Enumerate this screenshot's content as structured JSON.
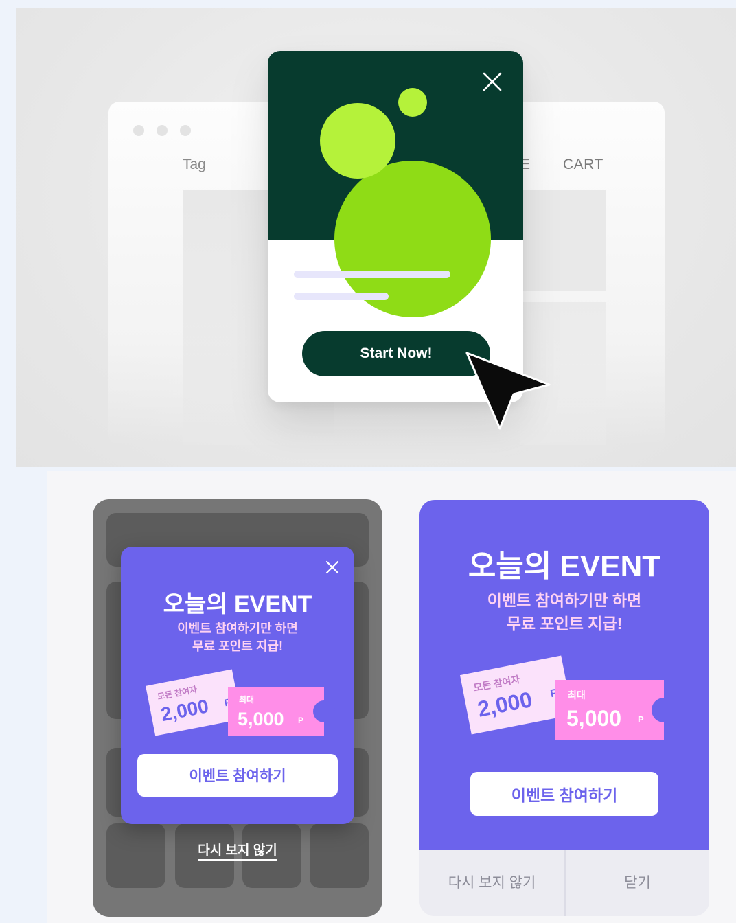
{
  "top_scene": {
    "browser": {
      "nav": {
        "tag": "Tag",
        "partial": "E",
        "cart": "CART"
      }
    },
    "modal": {
      "start_label": "Start Now!"
    },
    "colors": {
      "hero_bg": "#073b2e",
      "blob_light": "#b5f23a",
      "blob_main": "#8fdc16",
      "button": "#073b2e",
      "skeleton": "#e7e6fb"
    }
  },
  "event_small": {
    "title": "오늘의 EVENT",
    "subtitle_line1": "이벤트 참여하기만 하면",
    "subtitle_line2": "무료 포인트 지급!",
    "coupon_a": {
      "label": "모든 참여자",
      "value": "2,000",
      "unit": "P"
    },
    "coupon_b": {
      "label": "최대",
      "value": "5,000",
      "unit": "P"
    },
    "join_label": "이벤트 참여하기",
    "dont_show": "다시 보지 않기"
  },
  "event_card": {
    "title": "오늘의 EVENT",
    "subtitle_line1": "이벤트 참여하기만 하면",
    "subtitle_line2": "무료 포인트 지급!",
    "coupon_a": {
      "label": "모든 참여자",
      "value": "2,000",
      "unit": "P"
    },
    "coupon_b": {
      "label": "최대",
      "value": "5,000",
      "unit": "P"
    },
    "join_label": "이벤트 참여하기",
    "footer_dont_show": "다시 보지 않기",
    "footer_close": "닫기"
  },
  "colors": {
    "event_purple": "#6c63ec",
    "coupon_light": "#fbe2fb",
    "coupon_pink": "#ff8ee8",
    "subtitle_pink": "#ffd2f3",
    "overlay_gray": "#767676"
  }
}
